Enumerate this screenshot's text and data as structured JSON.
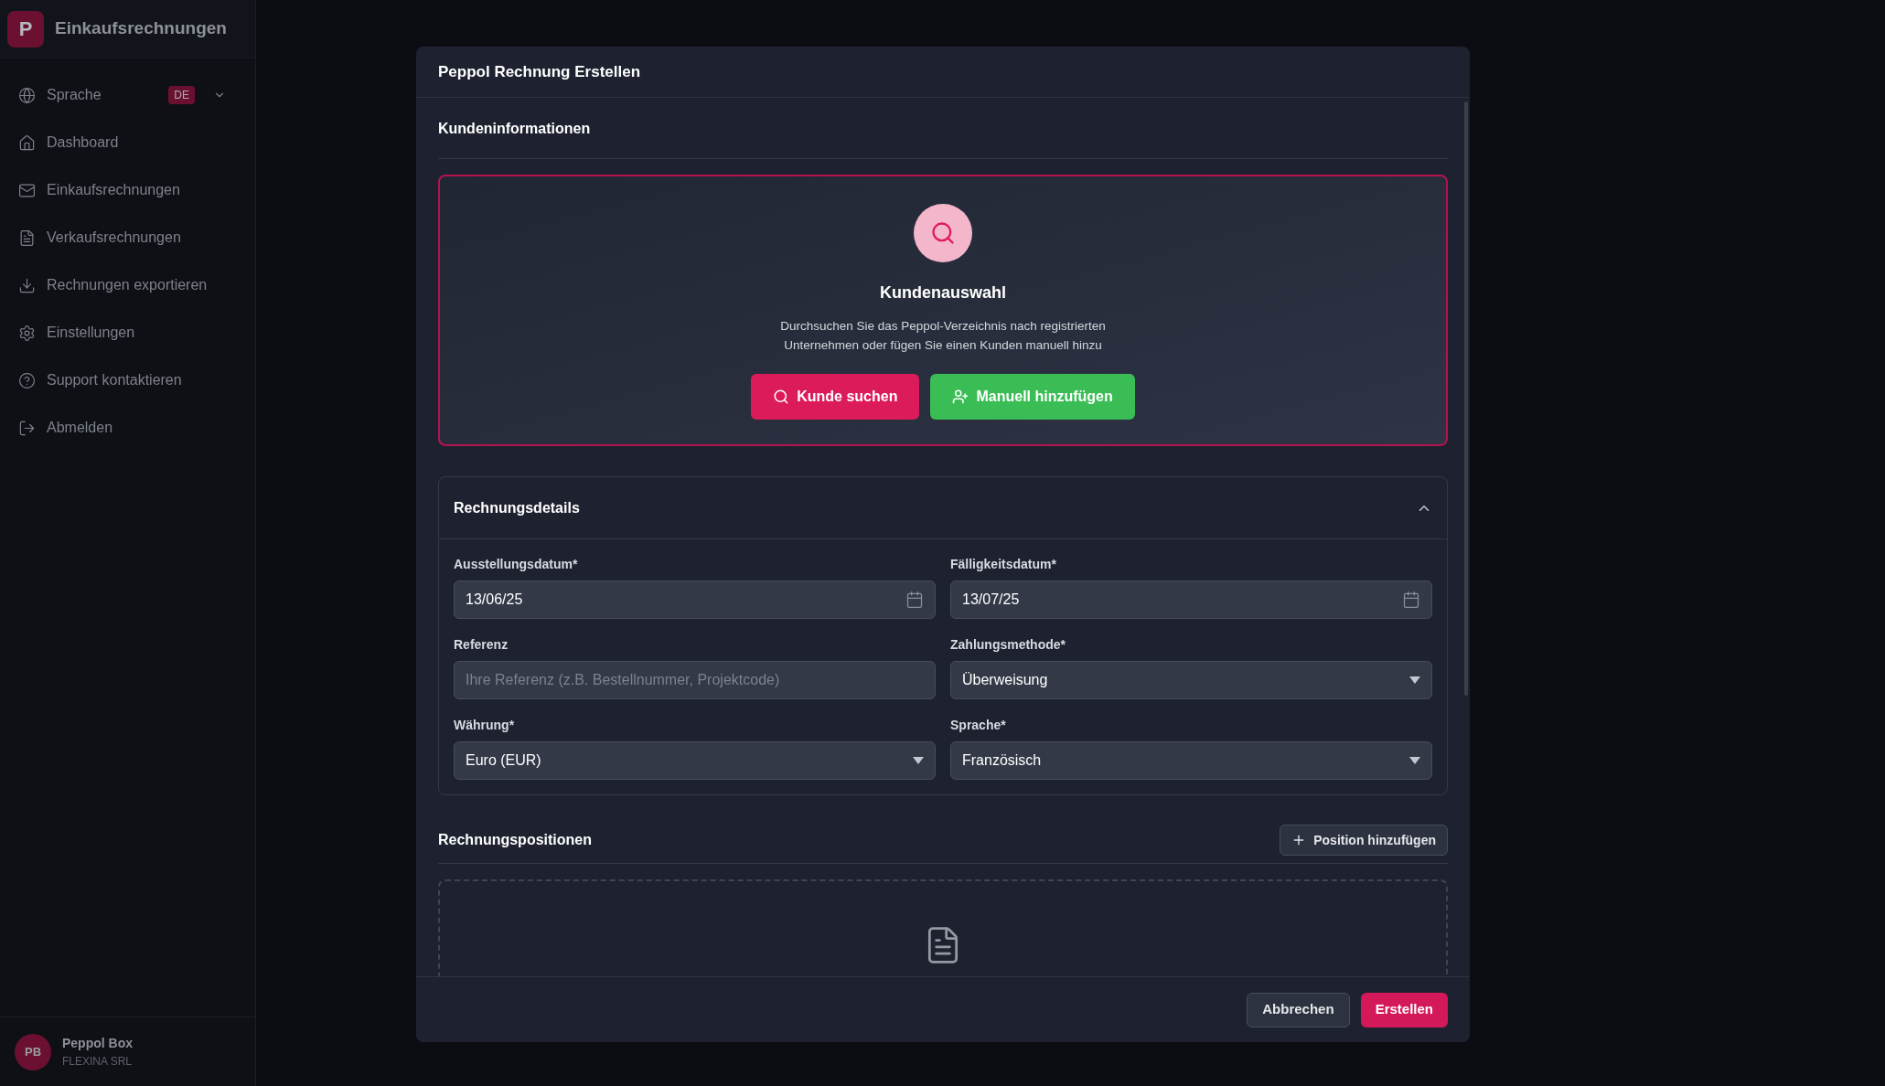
{
  "sidebar": {
    "app_title": "Einkaufsrechnungen",
    "logo_letter": "P",
    "language": {
      "label": "Sprache",
      "badge": "DE"
    },
    "items": [
      {
        "label": "Dashboard",
        "kind": "home"
      },
      {
        "label": "Einkaufsrechnungen",
        "kind": "mail"
      },
      {
        "label": "Verkaufsrechnungen",
        "kind": "file"
      },
      {
        "label": "Rechnungen exportieren",
        "kind": "download"
      },
      {
        "label": "Einstellungen",
        "kind": "settings"
      },
      {
        "label": "Support kontaktieren",
        "kind": "help"
      },
      {
        "label": "Abmelden",
        "kind": "logout"
      }
    ],
    "user": {
      "initials": "PB",
      "name": "Peppol Box",
      "company": "FLEXINA SRL"
    }
  },
  "dialog": {
    "title": "Peppol Rechnung Erstellen",
    "customer": {
      "heading": "Kundeninformationen",
      "title": "Kundenauswahl",
      "description": "Durchsuchen Sie das Peppol-Verzeichnis nach registrierten Unternehmen oder fügen Sie einen Kunden manuell hinzu",
      "search_button": "Kunde suchen",
      "add_button": "Manuell hinzufügen"
    },
    "details": {
      "title": "Rechnungsdetails",
      "expanded": true,
      "fields": [
        {
          "label": "Ausstellungsdatum*",
          "kind": "date",
          "value": "13/06/25"
        },
        {
          "label": "Fälligkeitsdatum*",
          "kind": "date",
          "value": "13/07/25"
        },
        {
          "label": "Referenz",
          "kind": "text",
          "placeholder": "Ihre Referenz (z.B. Bestellnummer, Projektcode)"
        },
        {
          "label": "Zahlungsmethode*",
          "kind": "select",
          "value": "Überweisung"
        },
        {
          "label": "Währung*",
          "kind": "select",
          "value": "Euro (EUR)"
        },
        {
          "label": "Sprache*",
          "kind": "select",
          "value": "Französisch"
        }
      ]
    },
    "positions": {
      "title": "Rechnungspositionen",
      "add_button": "Position hinzufügen"
    },
    "footer": {
      "cancel": "Abbrechen",
      "submit": "Erstellen"
    }
  }
}
